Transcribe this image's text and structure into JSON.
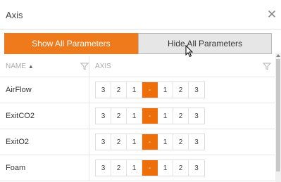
{
  "dialog": {
    "title": "Axis"
  },
  "buttons": {
    "show_all": "Show All Parameters",
    "hide_all": "Hide All Parameters"
  },
  "grid": {
    "columns": [
      "NAME",
      "AXIS"
    ],
    "sort_indicator": "▲",
    "rows": [
      {
        "name": "AirFlow",
        "steps": [
          "3",
          "2",
          "1",
          "-",
          "1",
          "2",
          "3"
        ]
      },
      {
        "name": "ExitCO2",
        "steps": [
          "3",
          "2",
          "1",
          "-",
          "1",
          "2",
          "3"
        ]
      },
      {
        "name": "ExitO2",
        "steps": [
          "3",
          "2",
          "1",
          "-",
          "1",
          "2",
          "3"
        ]
      },
      {
        "name": "Foam",
        "steps": [
          "3",
          "2",
          "1",
          "-",
          "1",
          "2",
          "3"
        ]
      }
    ]
  },
  "colors": {
    "accent": "#ee7a1c",
    "active_step": "#ee6f0a",
    "button_gray": "#e6e6e6"
  },
  "icons": {
    "close": "close-icon",
    "filter": "filter-icon",
    "cursor": "mouse-pointer-icon",
    "scroll_up": "scroll-up-arrow-icon"
  }
}
